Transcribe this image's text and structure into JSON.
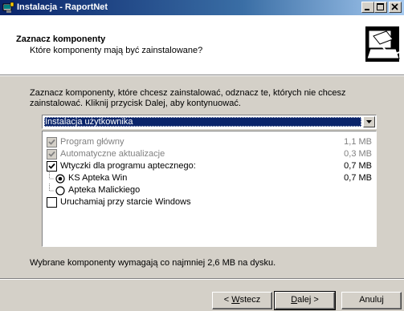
{
  "window": {
    "title": "Instalacja - RaportNet"
  },
  "header": {
    "title": "Zaznacz komponenty",
    "subtitle": "Które komponenty mają być zainstalowane?"
  },
  "instruction": "Zaznacz komponenty, które chcesz zainstalować, odznacz te, których nie chcesz zainstalować. Kliknij przycisk Dalej, aby kontynuować.",
  "setup_type": {
    "selected": "Instalacja użytkownika"
  },
  "components": [
    {
      "label": "Program główny",
      "size": "1,1 MB",
      "checked": true,
      "disabled": true
    },
    {
      "label": "Automatyczne aktualizacje",
      "size": "0,3 MB",
      "checked": true,
      "disabled": true
    },
    {
      "label": "Wtyczki dla programu aptecznego:",
      "size": "0,7 MB",
      "checked": true,
      "disabled": false
    },
    {
      "label": "KS Apteka Win",
      "size": "0,7 MB",
      "radio": true,
      "selected": true
    },
    {
      "label": "Apteka Malickiego",
      "size": "",
      "radio": true,
      "selected": false
    },
    {
      "label": "Uruchamiaj przy starcie Windows",
      "size": "",
      "checked": false,
      "disabled": false
    }
  ],
  "required_space": "Wybrane komponenty wymagają co najmniej 2,6 MB na dysku.",
  "buttons": {
    "back_prefix": "< ",
    "back_mnemonic": "W",
    "back_rest": "stecz",
    "next_mnemonic": "D",
    "next_rest": "alej >",
    "cancel": "Anuluj"
  }
}
